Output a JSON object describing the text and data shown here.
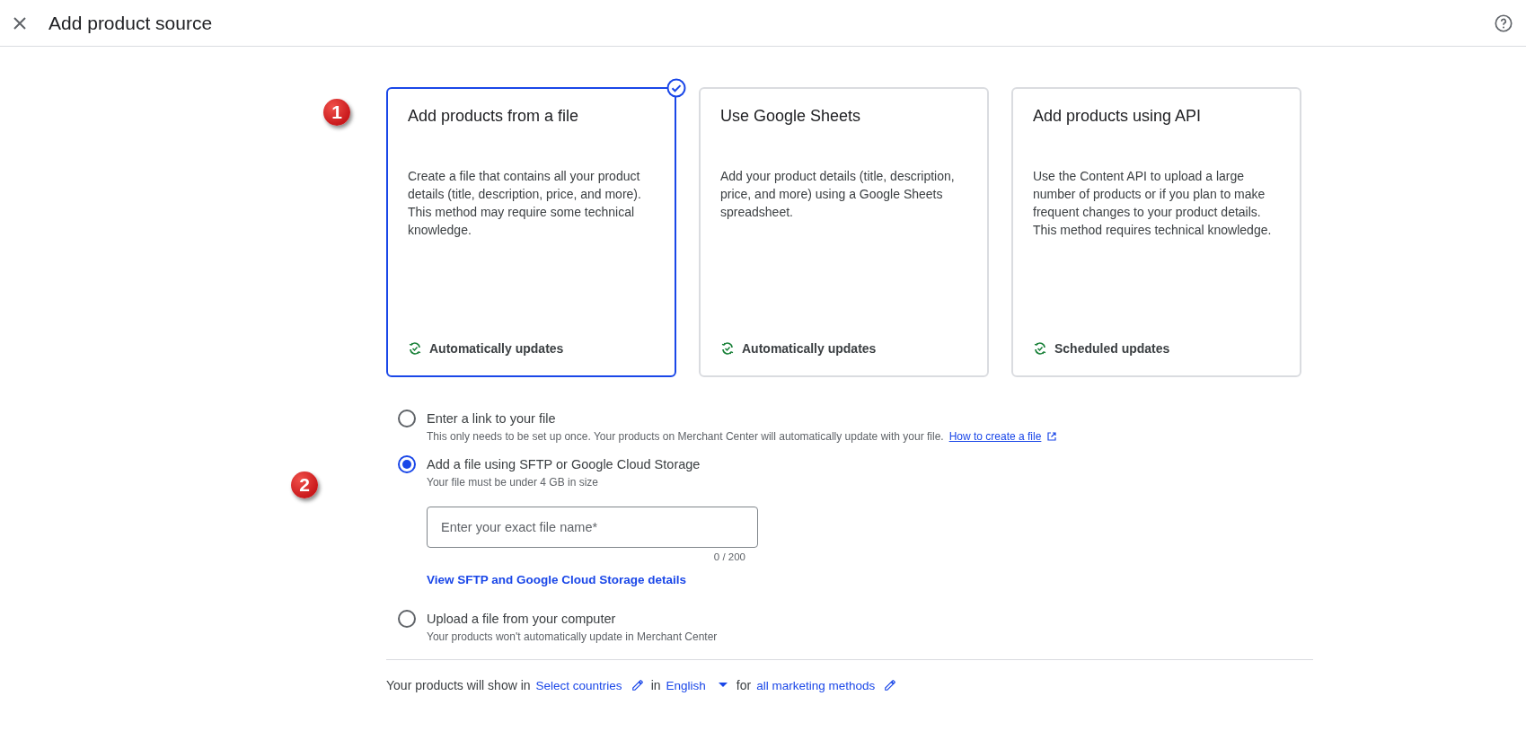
{
  "header": {
    "title": "Add product source"
  },
  "cards": {
    "marker": "1",
    "items": [
      {
        "title": "Add products from a file",
        "description": "Create a file that contains all your product details (title, description, price, and more). This method may require some technical knowledge.",
        "footer": "Automatically updates",
        "selected": true
      },
      {
        "title": "Use Google Sheets",
        "description": "Add your product details (title, description, price, and more) using a Google Sheets spreadsheet.",
        "footer": "Automatically updates",
        "selected": false
      },
      {
        "title": "Add products using API",
        "description": "Use the Content API to upload a large number of products or if you plan to make frequent changes to your product details. This method requires technical knowledge.",
        "footer": "Scheduled updates",
        "selected": false
      }
    ]
  },
  "options": [
    {
      "label": "Enter a link to your file",
      "hint": "This only needs to be set up once. Your products on Merchant Center will automatically update with your file.",
      "link": "How to create a file",
      "selected": false
    },
    {
      "label": "Add a file using SFTP or Google Cloud Storage",
      "hint": "Your file must be under 4 GB in size",
      "marker": "2",
      "selected": true,
      "field": {
        "placeholder": "Enter your exact file name*",
        "counter": "0 / 200"
      },
      "details_link": "View SFTP and Google Cloud Storage details"
    },
    {
      "label": "Upload a file from your computer",
      "hint": "Your products won't automatically update in Merchant Center",
      "selected": false
    }
  ],
  "footer": [
    {
      "kind": "text",
      "text": "Your products will show in"
    },
    {
      "kind": "edit",
      "text": "Select countries"
    },
    {
      "kind": "text",
      "text": "in"
    },
    {
      "kind": "dropdown",
      "text": "English"
    },
    {
      "kind": "text",
      "text": "for"
    },
    {
      "kind": "edit",
      "text": "all marketing methods"
    }
  ]
}
